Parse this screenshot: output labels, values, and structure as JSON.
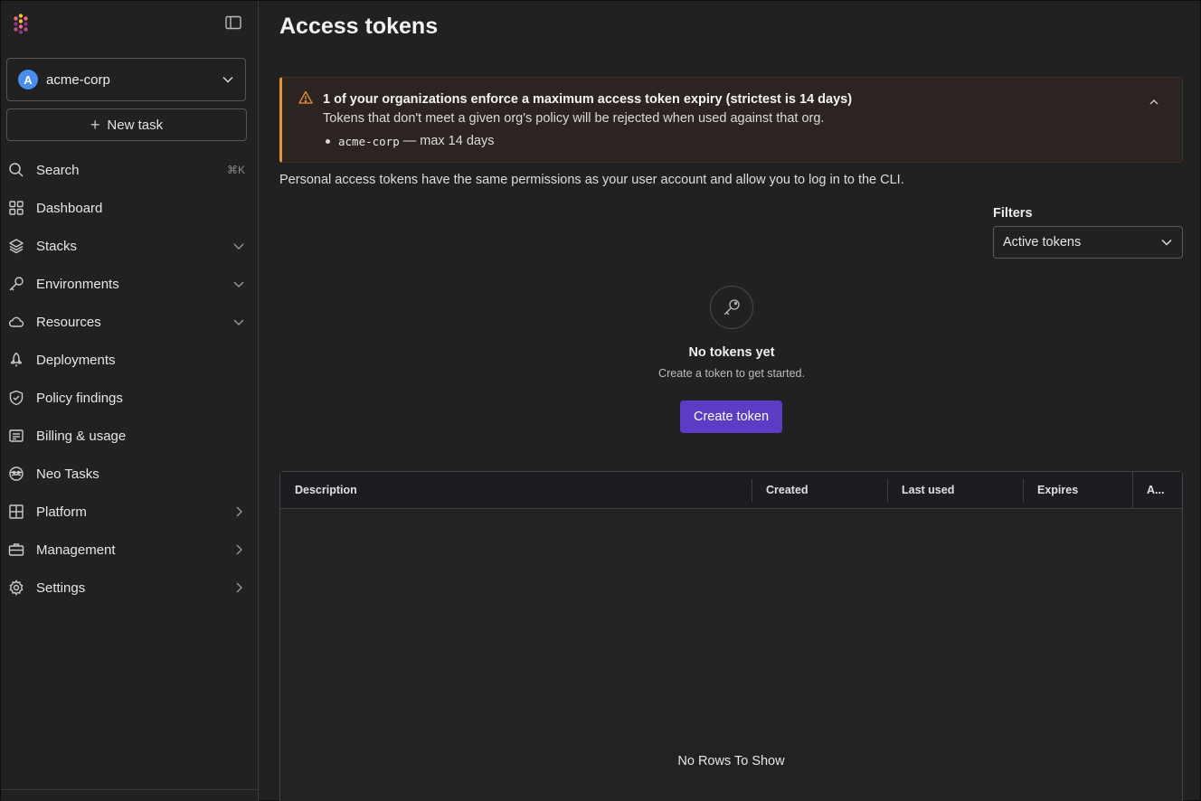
{
  "sidebar": {
    "org": {
      "initial": "A",
      "name": "acme-corp"
    },
    "new_task_label": "New task",
    "items": [
      {
        "label": "Search",
        "icon": "search-icon",
        "shortcut": "⌘K"
      },
      {
        "label": "Dashboard",
        "icon": "dashboard-icon"
      },
      {
        "label": "Stacks",
        "icon": "layers-icon",
        "expand": "chevron-down"
      },
      {
        "label": "Environments",
        "icon": "key-icon",
        "expand": "chevron-down"
      },
      {
        "label": "Resources",
        "icon": "cloud-icon",
        "expand": "chevron-down"
      },
      {
        "label": "Deployments",
        "icon": "rocket-icon"
      },
      {
        "label": "Policy findings",
        "icon": "shield-check-icon"
      },
      {
        "label": "Billing & usage",
        "icon": "receipt-icon"
      },
      {
        "label": "Neo Tasks",
        "icon": "neo-icon"
      },
      {
        "label": "Platform",
        "icon": "grid-icon",
        "expand": "chevron-right"
      },
      {
        "label": "Management",
        "icon": "briefcase-icon",
        "expand": "chevron-right"
      },
      {
        "label": "Settings",
        "icon": "gear-icon",
        "expand": "chevron-right"
      }
    ]
  },
  "main": {
    "title": "Access tokens",
    "alert": {
      "title": "1 of your organizations enforce a maximum access token expiry (strictest is 14 days)",
      "body": "Tokens that don't meet a given org's policy will be rejected when used against that org.",
      "item_code": "acme-corp",
      "item_text": "— max 14 days"
    },
    "description": "Personal access tokens have the same permissions as your user account and allow you to log in to the CLI.",
    "filters": {
      "label": "Filters",
      "value": "Active tokens"
    },
    "empty": {
      "title": "No tokens yet",
      "subtitle": "Create a token to get started.",
      "button": "Create token"
    },
    "table": {
      "columns": [
        "Description",
        "Created",
        "Last used",
        "Expires",
        "A..."
      ],
      "empty_text": "No Rows To Show"
    }
  },
  "colors": {
    "accent": "#5b3cc4",
    "warning": "#e8913a",
    "avatar": "#4a8ff0",
    "background": "#212121"
  }
}
